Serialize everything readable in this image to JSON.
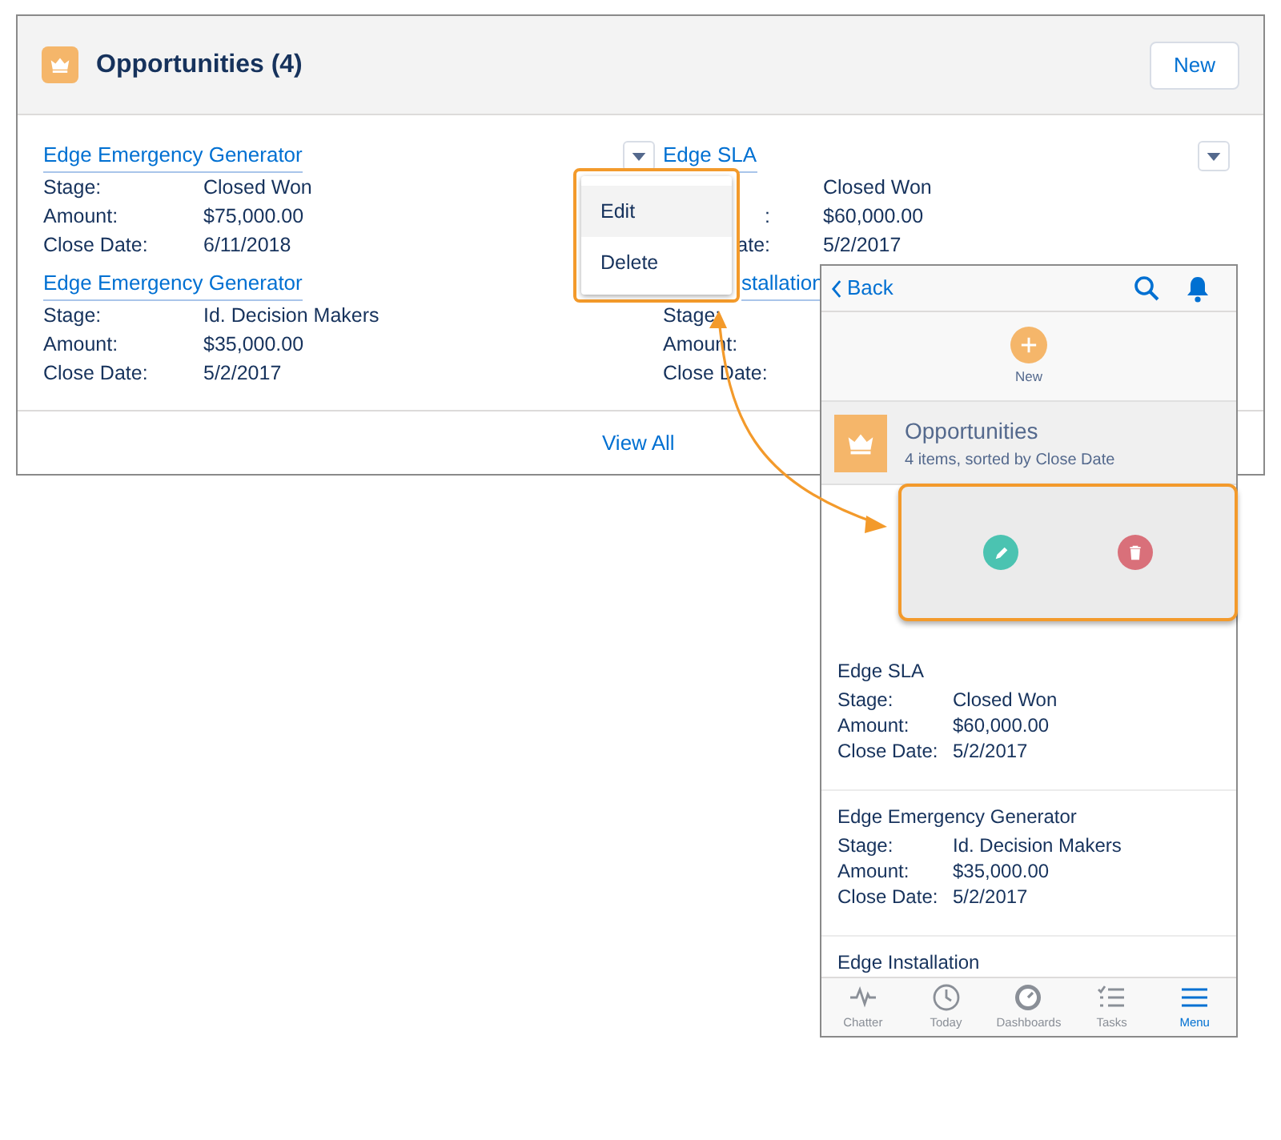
{
  "card": {
    "title": "Opportunities (4)",
    "new_button": "New",
    "view_all": "View All",
    "left_records": [
      {
        "name": "Edge Emergency Generator",
        "fields": [
          {
            "label": "Stage:",
            "value": "Closed Won"
          },
          {
            "label": "Amount:",
            "value": "$75,000.00"
          },
          {
            "label": "Close Date:",
            "value": "6/11/2018"
          }
        ]
      },
      {
        "name": "Edge Emergency Generator",
        "fields": [
          {
            "label": "Stage:",
            "value": "Id. Decision Makers"
          },
          {
            "label": "Amount:",
            "value": "$35,000.00"
          },
          {
            "label": "Close Date:",
            "value": "5/2/2017"
          }
        ]
      }
    ],
    "right_records": [
      {
        "name": "Edge SLA",
        "name_clipped": false,
        "fields": [
          {
            "value": "Closed Won",
            "clipped": true
          },
          {
            "label": ":",
            "value": "$60,000.00",
            "clipped": true
          },
          {
            "label": "ate:",
            "value": "5/2/2017",
            "clipped": true
          }
        ]
      },
      {
        "name": "stallation",
        "name_clipped": true,
        "fields": [
          {
            "label": "Stage:",
            "clipped": false
          },
          {
            "label": "Amount:",
            "clipped": false
          },
          {
            "label": "Close Date:",
            "clipped": false
          }
        ]
      }
    ],
    "menu": [
      {
        "label": "Edit",
        "highlighted": true
      },
      {
        "label": "Delete",
        "highlighted": false
      }
    ]
  },
  "phone": {
    "back": "Back",
    "new_action": "New",
    "list_title": "Opportunities",
    "list_subtitle": "4 items, sorted by Close Date",
    "records": [
      {
        "name": "Edge SLA",
        "fields": [
          {
            "label": "Stage:",
            "value": "Closed Won"
          },
          {
            "label": "Amount:",
            "value": "$60,000.00"
          },
          {
            "label": "Close Date:",
            "value": "5/2/2017"
          }
        ]
      },
      {
        "name": "Edge Emergency Generator",
        "fields": [
          {
            "label": "Stage:",
            "value": "Id. Decision Makers"
          },
          {
            "label": "Amount:",
            "value": "$35,000.00"
          },
          {
            "label": "Close Date:",
            "value": "5/2/2017"
          }
        ]
      },
      {
        "name": "Edge Installation"
      }
    ],
    "tabs": [
      {
        "label": "Chatter",
        "kind": "pulse",
        "selected": false
      },
      {
        "label": "Today",
        "kind": "clock",
        "selected": false
      },
      {
        "label": "Dashboards",
        "kind": "gauge",
        "selected": false
      },
      {
        "label": "Tasks",
        "kind": "tasks",
        "selected": false
      },
      {
        "label": "Menu",
        "kind": "menu",
        "selected": true
      }
    ]
  }
}
